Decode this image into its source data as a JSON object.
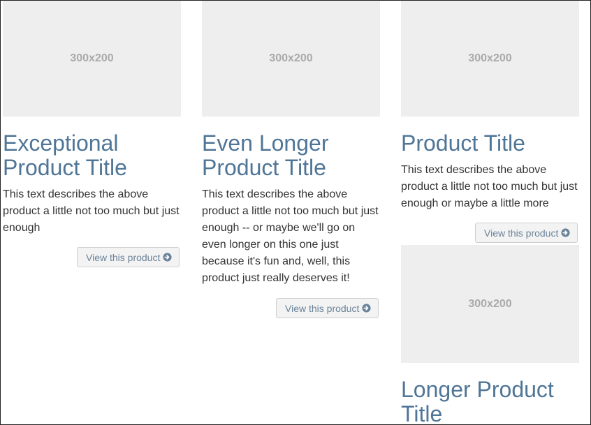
{
  "products": [
    {
      "image_label": "300x200",
      "title": "Exceptional Product Title",
      "description": "This text describes the above product a little not too much but just enough",
      "button_label": "View this product",
      "button_icon": "arrow-circle-right-icon"
    },
    {
      "image_label": "300x200",
      "title": "Even Longer Product Title",
      "description": "This text describes the above product a little not too much but just enough -- or maybe we'll go on even longer on this one just because it's fun and, well, this product just really deserves it!",
      "button_label": "View this product",
      "button_icon": "arrow-circle-right-icon"
    },
    {
      "image_label": "300x200",
      "title": "Product Title",
      "description": "This text describes the above product a little not too much but just enough or maybe a little more",
      "button_label": "View this product",
      "button_icon": "arrow-circle-right-icon"
    },
    {
      "image_label": "300x200",
      "title": "Longer Product Title"
    }
  ],
  "colors": {
    "title": "#4f7597",
    "placeholder_bg": "#eeeeee",
    "placeholder_text": "#aaaaaa",
    "button_bg": "#f3f3f3",
    "button_text": "#6b8399"
  }
}
